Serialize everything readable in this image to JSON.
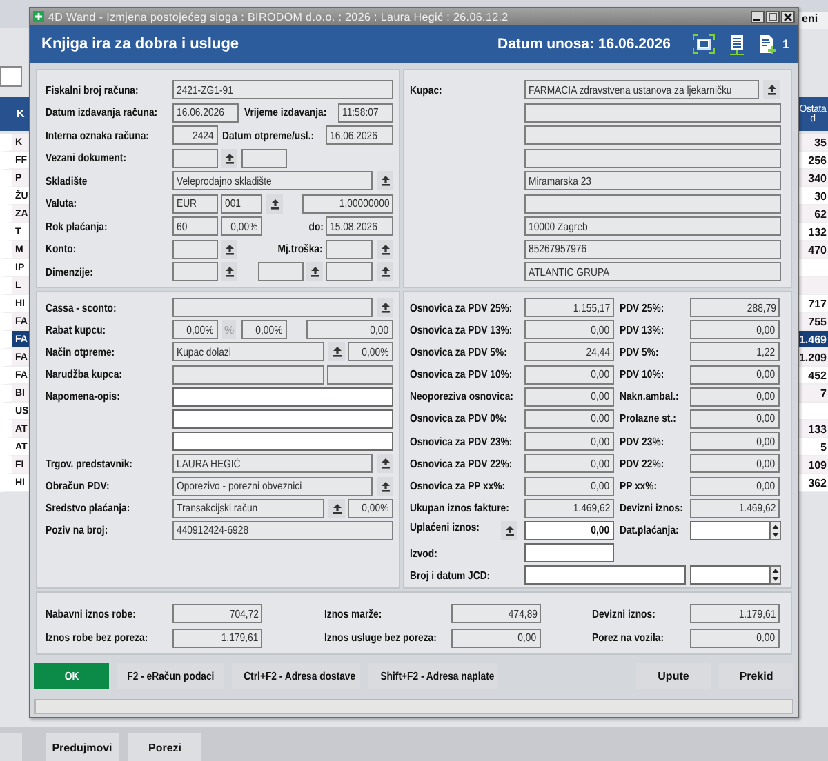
{
  "background": {
    "top_right_text": "eni",
    "list_header": {
      "column_1": "K",
      "column_2": "Ostata",
      "column_2_line_2": "d"
    },
    "rows": [
      {
        "column_1": "K",
        "column_2": "35",
        "selected": false
      },
      {
        "column_1": "FF",
        "column_2": "256",
        "selected": false
      },
      {
        "column_1": "P",
        "column_2": "340",
        "selected": false
      },
      {
        "column_1": "ŽU",
        "column_2": "30",
        "selected": false
      },
      {
        "column_1": "ZA",
        "column_2": "62",
        "selected": false
      },
      {
        "column_1": "T",
        "column_2": "132",
        "selected": false
      },
      {
        "column_1": "M",
        "column_2": "470",
        "selected": false
      },
      {
        "column_1": "IP",
        "selected": false
      },
      {
        "column_1": "L",
        "selected": false
      },
      {
        "column_1": "HI",
        "column_2": "717",
        "selected": false
      },
      {
        "column_1": "FA",
        "column_2": "755",
        "selected": false
      },
      {
        "column_1": "FA",
        "column_2": "1.469",
        "selected": true
      },
      {
        "column_1": "FA",
        "column_2": "1.209",
        "selected": false
      },
      {
        "column_1": "FA",
        "column_2": "452",
        "selected": false
      },
      {
        "column_1": "BI",
        "column_2": "7",
        "selected": false
      },
      {
        "column_1": "US",
        "selected": false
      },
      {
        "column_1": "AT",
        "column_2": "133",
        "selected": false
      },
      {
        "column_1": "AT",
        "column_2": "5",
        "selected": false
      },
      {
        "column_1": "FI",
        "column_2": "109",
        "selected": false
      },
      {
        "column_1": "HI",
        "column_2": "362",
        "selected": false
      }
    ],
    "buttons": [
      "Predujmovi",
      "Porezi"
    ]
  },
  "dialog": {
    "window": {
      "title": "4D Wand - Izmjena postojećeg sloga : BIRODOM d.o.o. : 2026 : Laura Hegić : 26.06.12.2"
    },
    "header": {
      "title": "Knjiga ira za dobra i usluge",
      "entry_date": "Datum unosa: 16.06.2026",
      "count": "1"
    },
    "top_left": {
      "rows": [
        [
          {
            "kind": "label",
            "text": "Fiskalni broj računa:"
          },
          {
            "kind": "field",
            "value": "2421-ZG1-91"
          }
        ],
        [
          {
            "kind": "label",
            "text": "Datum izdavanja računa:"
          },
          {
            "kind": "field",
            "value": "16.06.2026"
          },
          {
            "kind": "label",
            "text": "Vrijeme izdavanja:"
          },
          {
            "kind": "field",
            "value": "11:58:07"
          }
        ],
        [
          {
            "kind": "label",
            "text": "Interna oznaka računa:"
          },
          {
            "kind": "field",
            "value": "2424"
          },
          {
            "kind": "label",
            "text": "Datum otpreme/usl.:"
          },
          {
            "kind": "field",
            "value": "16.06.2026"
          }
        ],
        [
          {
            "kind": "label",
            "text": "Vezani dokument:"
          },
          {
            "kind": "field"
          },
          {
            "kind": "picker"
          },
          {
            "kind": "field"
          }
        ],
        [
          {
            "kind": "label",
            "text": "Skladište"
          },
          {
            "kind": "field",
            "value": "Veleprodajno skladište"
          },
          {
            "kind": "picker"
          }
        ],
        [
          {
            "kind": "label",
            "text": "Valuta:"
          },
          {
            "kind": "field",
            "value": "EUR"
          },
          {
            "kind": "field",
            "value": "001"
          },
          {
            "kind": "picker"
          },
          {
            "kind": "field",
            "value": "1,00000000"
          }
        ],
        [
          {
            "kind": "label",
            "text": "Rok plaćanja:"
          },
          {
            "kind": "field",
            "value": "60"
          },
          {
            "kind": "field",
            "value": "0,00%"
          },
          {
            "kind": "label",
            "text": "do:"
          },
          {
            "kind": "field",
            "value": "15.08.2026"
          }
        ],
        [
          {
            "kind": "label",
            "text": "Konto:"
          },
          {
            "kind": "field"
          },
          {
            "kind": "picker"
          },
          {
            "kind": "label",
            "text": "Mj.troška:"
          },
          {
            "kind": "field"
          },
          {
            "kind": "picker"
          }
        ],
        [
          {
            "kind": "label",
            "text": "Dimenzije:"
          },
          {
            "kind": "field"
          },
          {
            "kind": "picker"
          },
          {
            "kind": "field"
          },
          {
            "kind": "picker"
          },
          {
            "kind": "field"
          },
          {
            "kind": "picker"
          }
        ]
      ]
    },
    "top_right": {
      "rows": [
        [
          {
            "kind": "label",
            "text": "Kupac:"
          },
          {
            "kind": "field",
            "value": "FARMACIA zdravstvena ustanova za ljekarničku"
          },
          {
            "kind": "picker"
          }
        ],
        [
          {
            "kind": "field"
          }
        ],
        [
          {
            "kind": "field"
          }
        ],
        [
          {
            "kind": "field"
          }
        ],
        [
          {
            "kind": "field",
            "value": "Miramarska 23"
          }
        ],
        [
          {
            "kind": "field"
          }
        ],
        [
          {
            "kind": "field",
            "value": "10000 Zagreb"
          }
        ],
        [
          {
            "kind": "field",
            "value": "85267957976"
          }
        ],
        [
          {
            "kind": "field",
            "value": "ATLANTIC GRUPA"
          }
        ]
      ]
    },
    "middle_left": {
      "rows": [
        [
          {
            "kind": "label",
            "text": "Cassa - sconto:"
          },
          {
            "kind": "field"
          },
          {
            "kind": "picker"
          }
        ],
        [
          {
            "kind": "label",
            "text": "Rabat kupcu:"
          },
          {
            "kind": "field",
            "value": "0,00%"
          },
          {
            "kind": "toggle",
            "label": "%"
          },
          {
            "kind": "field",
            "value": "0,00%"
          },
          {
            "kind": "field",
            "value": "0,00"
          }
        ],
        [
          {
            "kind": "label",
            "text": "Način otpreme:"
          },
          {
            "kind": "field",
            "value": "Kupac dolazi"
          },
          {
            "kind": "picker"
          },
          {
            "kind": "field",
            "value": "0,00%"
          }
        ],
        [
          {
            "kind": "label",
            "text": "Narudžba kupca:"
          },
          {
            "kind": "field"
          },
          {
            "kind": "field"
          }
        ],
        [
          {
            "kind": "label",
            "text": "Napomena-opis:"
          },
          {
            "kind": "input"
          }
        ],
        [
          {
            "kind": "input"
          }
        ],
        [
          {
            "kind": "input"
          }
        ],
        [
          {
            "kind": "label",
            "text": "Trgov. predstavnik:"
          },
          {
            "kind": "field",
            "value": "LAURA HEGIĆ"
          },
          {
            "kind": "picker"
          }
        ],
        [
          {
            "kind": "label",
            "text": "Obračun PDV:"
          },
          {
            "kind": "field",
            "value": "Oporezivo - porezni obveznici"
          },
          {
            "kind": "picker"
          }
        ],
        [
          {
            "kind": "label",
            "text": "Sredstvo plaćanja:"
          },
          {
            "kind": "field",
            "value": "Transakcijski račun"
          },
          {
            "kind": "picker"
          },
          {
            "kind": "field",
            "value": "0,00%"
          }
        ],
        [
          {
            "kind": "label",
            "text": "Poziv na broj:"
          },
          {
            "kind": "field",
            "value": "440912424-6928"
          }
        ]
      ]
    },
    "middle_right": {
      "rows": [
        [
          {
            "kind": "label",
            "text": "Osnovica za PDV 25%:"
          },
          {
            "kind": "field",
            "value": "1.155,17"
          },
          {
            "kind": "label",
            "text": "PDV 25%:"
          },
          {
            "kind": "field",
            "value": "288,79"
          }
        ],
        [
          {
            "kind": "label",
            "text": "Osnovica za PDV 13%:"
          },
          {
            "kind": "field",
            "value": "0,00"
          },
          {
            "kind": "label",
            "text": "PDV 13%:"
          },
          {
            "kind": "field",
            "value": "0,00"
          }
        ],
        [
          {
            "kind": "label",
            "text": "Osnovica za PDV 5%:"
          },
          {
            "kind": "field",
            "value": "24,44"
          },
          {
            "kind": "label",
            "text": "PDV 5%:"
          },
          {
            "kind": "field",
            "value": "1,22"
          }
        ],
        [
          {
            "kind": "label",
            "text": "Osnovica za PDV 10%:"
          },
          {
            "kind": "field",
            "value": "0,00"
          },
          {
            "kind": "label",
            "text": "PDV 10%:"
          },
          {
            "kind": "field",
            "value": "0,00"
          }
        ],
        [
          {
            "kind": "label",
            "text": "Neoporeziva osnovica:"
          },
          {
            "kind": "field",
            "value": "0,00"
          },
          {
            "kind": "label",
            "text": "Nakn.ambal.:"
          },
          {
            "kind": "field",
            "value": "0,00"
          }
        ],
        [
          {
            "kind": "label",
            "text": "Osnovica za PDV 0%:"
          },
          {
            "kind": "field",
            "value": "0,00"
          },
          {
            "kind": "label",
            "text": "Prolazne st.:"
          },
          {
            "kind": "field",
            "value": "0,00"
          }
        ],
        [
          {
            "kind": "label",
            "text": "Osnovica za PDV 23%:"
          },
          {
            "kind": "field",
            "value": "0,00"
          },
          {
            "kind": "label",
            "text": "PDV 23%:"
          },
          {
            "kind": "field",
            "value": "0,00"
          }
        ],
        [
          {
            "kind": "label",
            "text": "Osnovica za PDV 22%:"
          },
          {
            "kind": "field",
            "value": "0,00"
          },
          {
            "kind": "label",
            "text": "PDV 22%:"
          },
          {
            "kind": "field",
            "value": "0,00"
          }
        ],
        [
          {
            "kind": "label",
            "text": "Osnovica za PP xx%:"
          },
          {
            "kind": "field",
            "value": "0,00"
          },
          {
            "kind": "label",
            "text": "PP xx%:"
          },
          {
            "kind": "field",
            "value": "0,00"
          }
        ],
        [
          {
            "kind": "label",
            "text": "Ukupan iznos fakture:"
          },
          {
            "kind": "field",
            "value": "1.469,62"
          },
          {
            "kind": "label",
            "text": "Devizni iznos:"
          },
          {
            "kind": "field",
            "value": "1.469,62"
          }
        ],
        [
          {
            "kind": "label",
            "text": "Uplaćeni iznos:",
            "picker": true
          },
          {
            "kind": "input",
            "value": "0,00"
          },
          {
            "kind": "label",
            "text": "Dat.plaćanja:"
          },
          {
            "kind": "input"
          },
          {
            "kind": "spinner"
          }
        ],
        [
          {
            "kind": "label",
            "text": "Izvod:"
          },
          {
            "kind": "input"
          }
        ],
        [
          {
            "kind": "label",
            "text": "Broj i datum JCD:"
          },
          {
            "kind": "input"
          },
          {
            "kind": "input"
          },
          {
            "kind": "spinner"
          }
        ]
      ]
    },
    "totals": {
      "rows": [
        [
          {
            "kind": "label",
            "text": "Nabavni iznos robe:"
          },
          {
            "kind": "field",
            "value": "704,72"
          },
          {
            "kind": "label",
            "text": "Iznos marže:"
          },
          {
            "kind": "field",
            "value": "474,89"
          },
          {
            "kind": "label",
            "text": "Devizni iznos:"
          },
          {
            "kind": "field",
            "value": "1.179,61"
          }
        ],
        [
          {
            "kind": "label",
            "text": "Iznos robe bez poreza:"
          },
          {
            "kind": "field",
            "value": "1.179,61"
          },
          {
            "kind": "label",
            "text": "Iznos usluge bez poreza:"
          },
          {
            "kind": "field",
            "value": "0,00"
          },
          {
            "kind": "label",
            "text": "Porez na vozila:"
          },
          {
            "kind": "field",
            "value": "0,00"
          }
        ]
      ]
    },
    "buttons_left": [
      {
        "label": "OK",
        "kind": "primary"
      },
      {
        "label": "F2 - eRačun podaci",
        "kind": "normal"
      },
      {
        "label": "Ctrl+F2 - Adresa dostave",
        "kind": "normal"
      },
      {
        "label": "Shift+F2 - Adresa naplate",
        "kind": "normal"
      }
    ],
    "buttons_right": [
      {
        "label": "Upute",
        "kind": "normal"
      },
      {
        "label": "Prekid",
        "kind": "normal"
      }
    ]
  }
}
